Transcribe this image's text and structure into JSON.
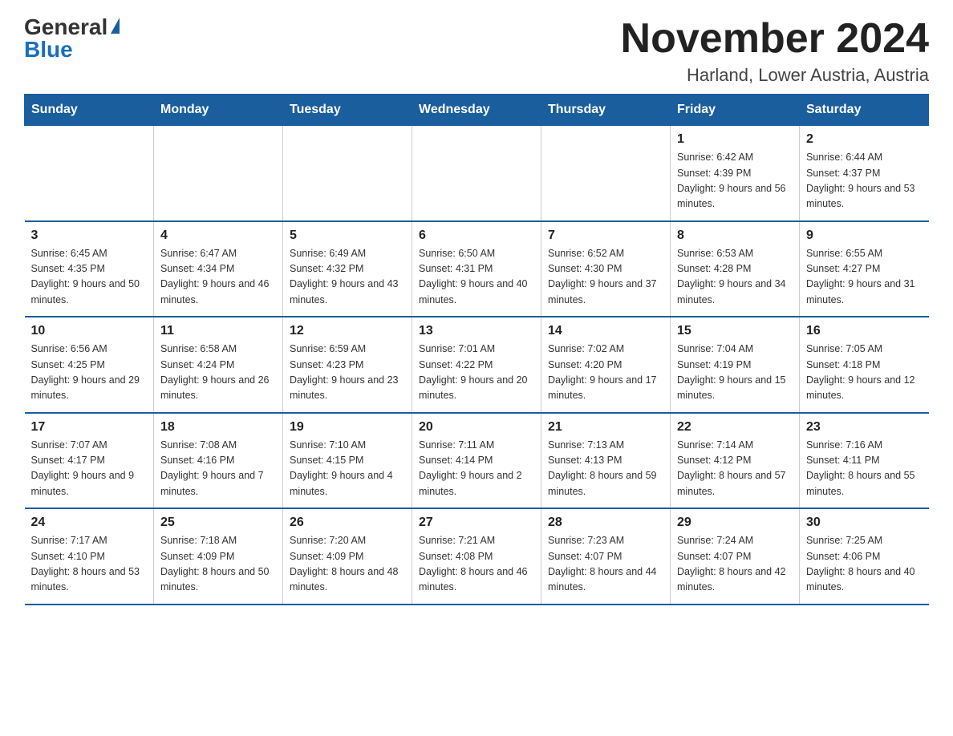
{
  "logo": {
    "general": "General",
    "blue": "Blue"
  },
  "title": "November 2024",
  "location": "Harland, Lower Austria, Austria",
  "days_of_week": [
    "Sunday",
    "Monday",
    "Tuesday",
    "Wednesday",
    "Thursday",
    "Friday",
    "Saturday"
  ],
  "weeks": [
    {
      "days": [
        {
          "number": "",
          "info": ""
        },
        {
          "number": "",
          "info": ""
        },
        {
          "number": "",
          "info": ""
        },
        {
          "number": "",
          "info": ""
        },
        {
          "number": "",
          "info": ""
        },
        {
          "number": "1",
          "info": "Sunrise: 6:42 AM\nSunset: 4:39 PM\nDaylight: 9 hours and 56 minutes."
        },
        {
          "number": "2",
          "info": "Sunrise: 6:44 AM\nSunset: 4:37 PM\nDaylight: 9 hours and 53 minutes."
        }
      ]
    },
    {
      "days": [
        {
          "number": "3",
          "info": "Sunrise: 6:45 AM\nSunset: 4:35 PM\nDaylight: 9 hours and 50 minutes."
        },
        {
          "number": "4",
          "info": "Sunrise: 6:47 AM\nSunset: 4:34 PM\nDaylight: 9 hours and 46 minutes."
        },
        {
          "number": "5",
          "info": "Sunrise: 6:49 AM\nSunset: 4:32 PM\nDaylight: 9 hours and 43 minutes."
        },
        {
          "number": "6",
          "info": "Sunrise: 6:50 AM\nSunset: 4:31 PM\nDaylight: 9 hours and 40 minutes."
        },
        {
          "number": "7",
          "info": "Sunrise: 6:52 AM\nSunset: 4:30 PM\nDaylight: 9 hours and 37 minutes."
        },
        {
          "number": "8",
          "info": "Sunrise: 6:53 AM\nSunset: 4:28 PM\nDaylight: 9 hours and 34 minutes."
        },
        {
          "number": "9",
          "info": "Sunrise: 6:55 AM\nSunset: 4:27 PM\nDaylight: 9 hours and 31 minutes."
        }
      ]
    },
    {
      "days": [
        {
          "number": "10",
          "info": "Sunrise: 6:56 AM\nSunset: 4:25 PM\nDaylight: 9 hours and 29 minutes."
        },
        {
          "number": "11",
          "info": "Sunrise: 6:58 AM\nSunset: 4:24 PM\nDaylight: 9 hours and 26 minutes."
        },
        {
          "number": "12",
          "info": "Sunrise: 6:59 AM\nSunset: 4:23 PM\nDaylight: 9 hours and 23 minutes."
        },
        {
          "number": "13",
          "info": "Sunrise: 7:01 AM\nSunset: 4:22 PM\nDaylight: 9 hours and 20 minutes."
        },
        {
          "number": "14",
          "info": "Sunrise: 7:02 AM\nSunset: 4:20 PM\nDaylight: 9 hours and 17 minutes."
        },
        {
          "number": "15",
          "info": "Sunrise: 7:04 AM\nSunset: 4:19 PM\nDaylight: 9 hours and 15 minutes."
        },
        {
          "number": "16",
          "info": "Sunrise: 7:05 AM\nSunset: 4:18 PM\nDaylight: 9 hours and 12 minutes."
        }
      ]
    },
    {
      "days": [
        {
          "number": "17",
          "info": "Sunrise: 7:07 AM\nSunset: 4:17 PM\nDaylight: 9 hours and 9 minutes."
        },
        {
          "number": "18",
          "info": "Sunrise: 7:08 AM\nSunset: 4:16 PM\nDaylight: 9 hours and 7 minutes."
        },
        {
          "number": "19",
          "info": "Sunrise: 7:10 AM\nSunset: 4:15 PM\nDaylight: 9 hours and 4 minutes."
        },
        {
          "number": "20",
          "info": "Sunrise: 7:11 AM\nSunset: 4:14 PM\nDaylight: 9 hours and 2 minutes."
        },
        {
          "number": "21",
          "info": "Sunrise: 7:13 AM\nSunset: 4:13 PM\nDaylight: 8 hours and 59 minutes."
        },
        {
          "number": "22",
          "info": "Sunrise: 7:14 AM\nSunset: 4:12 PM\nDaylight: 8 hours and 57 minutes."
        },
        {
          "number": "23",
          "info": "Sunrise: 7:16 AM\nSunset: 4:11 PM\nDaylight: 8 hours and 55 minutes."
        }
      ]
    },
    {
      "days": [
        {
          "number": "24",
          "info": "Sunrise: 7:17 AM\nSunset: 4:10 PM\nDaylight: 8 hours and 53 minutes."
        },
        {
          "number": "25",
          "info": "Sunrise: 7:18 AM\nSunset: 4:09 PM\nDaylight: 8 hours and 50 minutes."
        },
        {
          "number": "26",
          "info": "Sunrise: 7:20 AM\nSunset: 4:09 PM\nDaylight: 8 hours and 48 minutes."
        },
        {
          "number": "27",
          "info": "Sunrise: 7:21 AM\nSunset: 4:08 PM\nDaylight: 8 hours and 46 minutes."
        },
        {
          "number": "28",
          "info": "Sunrise: 7:23 AM\nSunset: 4:07 PM\nDaylight: 8 hours and 44 minutes."
        },
        {
          "number": "29",
          "info": "Sunrise: 7:24 AM\nSunset: 4:07 PM\nDaylight: 8 hours and 42 minutes."
        },
        {
          "number": "30",
          "info": "Sunrise: 7:25 AM\nSunset: 4:06 PM\nDaylight: 8 hours and 40 minutes."
        }
      ]
    }
  ]
}
